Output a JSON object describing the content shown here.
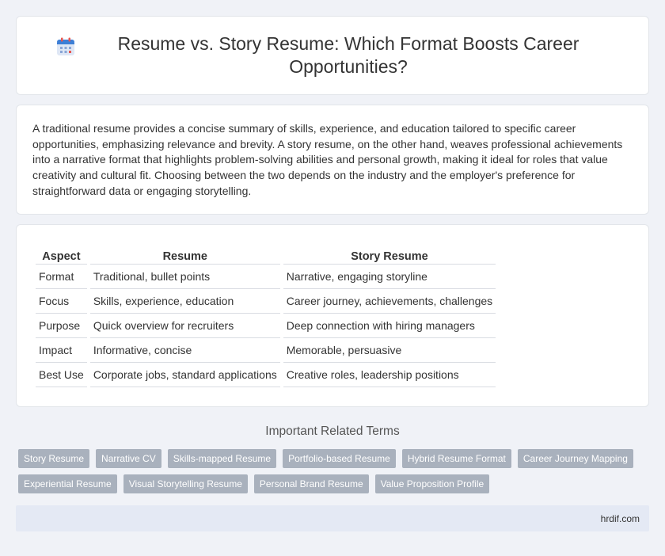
{
  "header": {
    "title": "Resume vs. Story Resume: Which Format Boosts Career Opportunities?",
    "icon": "calendar-icon"
  },
  "intro": {
    "text": "A traditional resume provides a concise summary of skills, experience, and education tailored to specific career opportunities, emphasizing relevance and brevity. A story resume, on the other hand, weaves professional achievements into a narrative format that highlights problem-solving abilities and personal growth, making it ideal for roles that value creativity and cultural fit. Choosing between the two depends on the industry and the employer's preference for straightforward data or engaging storytelling."
  },
  "comparison": {
    "headers": [
      "Aspect",
      "Resume",
      "Story Resume"
    ],
    "rows": [
      [
        "Format",
        "Traditional, bullet points",
        "Narrative, engaging storyline"
      ],
      [
        "Focus",
        "Skills, experience, education",
        "Career journey, achievements, challenges"
      ],
      [
        "Purpose",
        "Quick overview for recruiters",
        "Deep connection with hiring managers"
      ],
      [
        "Impact",
        "Informative, concise",
        "Memorable, persuasive"
      ],
      [
        "Best Use",
        "Corporate jobs, standard applications",
        "Creative roles, leadership positions"
      ]
    ]
  },
  "related": {
    "title": "Important Related Terms",
    "tags": [
      "Story Resume",
      "Narrative CV",
      "Skills-mapped Resume",
      "Portfolio-based Resume",
      "Hybrid Resume Format",
      "Career Journey Mapping",
      "Experiential Resume",
      "Visual Storytelling Resume",
      "Personal Brand Resume",
      "Value Proposition Profile"
    ]
  },
  "footer": {
    "site": "hrdif.com"
  },
  "colors": {
    "background": "#f0f2f7",
    "tag_bg": "#a9b1bd",
    "footer_bg": "#e4e9f4",
    "icon_blue": "#3d7fd6",
    "icon_red": "#e8564f"
  }
}
